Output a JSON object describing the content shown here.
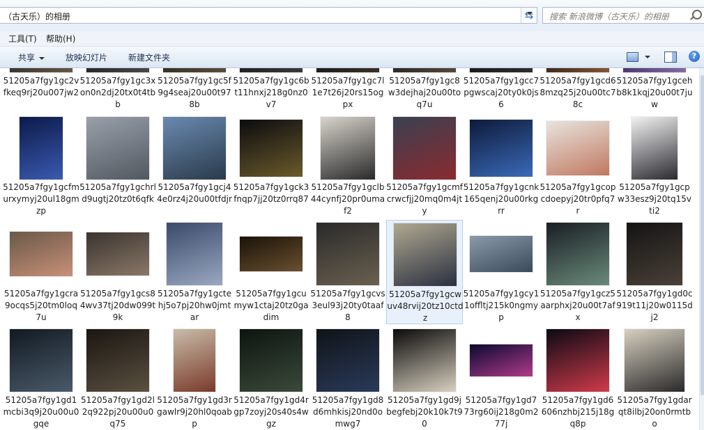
{
  "address": {
    "path": "（古天乐）的相册"
  },
  "search": {
    "placeholder": "搜索 新浪微博（古天乐）的相册"
  },
  "menu": [
    {
      "label": "工具(T)"
    },
    {
      "label": "帮助(H)"
    }
  ],
  "toolbar": {
    "share_label": "共享",
    "slideshow_label": "放映幻灯片",
    "new_folder_label": "新建文件夹",
    "help_symbol": "?"
  },
  "rows": [
    [
      {
        "label": "51205a7fgy1gc2vfkeq9rj20u007jw2",
        "colors": [
          "#2a2a2a",
          "#6b5a44"
        ]
      },
      {
        "label": "51205a7fgy1gc3xon0n2dj20tx0t4tbb",
        "colors": [
          "#1e1e1e",
          "#4a4a4a"
        ]
      },
      {
        "label": "51205a7fgy1gc5f9g4seaj20u00t978b",
        "colors": [
          "#2c2820",
          "#5c4f3c"
        ]
      },
      {
        "label": "51205a7fgy1gc6bt11hnxj218g0nz0v7",
        "colors": [
          "#1a1a1a",
          "#3a3a3a"
        ]
      },
      {
        "label": "51205a7fgy1gc7l1e7t26j20rs15ogpx",
        "colors": [
          "#151515",
          "#3a3226"
        ]
      },
      {
        "label": "51205a7fgy1gc8w3dejhaj20u00toq7u",
        "colors": [
          "#1f1f1f",
          "#5a4a3a"
        ]
      },
      {
        "label": "51205a7fgy1gcc7pgwscaj20ty0k0js6",
        "colors": [
          "#141414",
          "#2e2e2e"
        ]
      },
      {
        "label": "51205a7fgy1gcd68mzq25j20u00tc78c",
        "colors": [
          "#2a1a12",
          "#8a5a36"
        ]
      },
      {
        "label": "51205a7fgy1gcehb8k1kqj20u00t7juw",
        "colors": [
          "#3a2a5a",
          "#8a70a8"
        ]
      }
    ],
    [
      {
        "label": "51205a7fgy1gcfmurxymyj20ul18gmzp",
        "colors": [
          "#0c1a4a",
          "#3a5ab0"
        ]
      },
      {
        "label": "51205a7fgy1gchrld9ugtj20tz0t6qfk",
        "colors": [
          "#9aa0aa",
          "#505860"
        ]
      },
      {
        "label": "51205a7fgy1gcj44e0rz4j20u00tfdjr",
        "colors": [
          "#6a8ab0",
          "#2a3a4a"
        ]
      },
      {
        "label": "51205a7fgy1gck3fnqp7jj20tz0rrq87",
        "colors": [
          "#0c0c10",
          "#6a5a2a"
        ]
      },
      {
        "label": "51205a7fgy1gclb44cynfj20pr0umaf2",
        "colors": [
          "#d8d4cc",
          "#2a2a2a"
        ]
      },
      {
        "label": "51205a7fgy1gcmfcrwcfjj20mq0m4jty",
        "colors": [
          "#3a4050",
          "#8a2a30"
        ]
      },
      {
        "label": "51205a7fgy1gcnk165qenj20u00rkgrr",
        "colors": [
          "#0e1a3a",
          "#3a6ab8"
        ]
      },
      {
        "label": "51205a7fgy1gcopcdoepyj20tr0pfq7r",
        "colors": [
          "#e8e4de",
          "#c07860"
        ]
      },
      {
        "label": "51205a7fgy1gcpw33esz9j20tq15vti2",
        "colors": [
          "#f2f2f2",
          "#2a2a30"
        ]
      }
    ],
    [
      {
        "label": "51205a7fgy1gcra9ocqs5j20tm0loq7u",
        "colors": [
          "#6a5848",
          "#c89078"
        ]
      },
      {
        "label": "51205a7fgy1gcs84wv37tj20dw099t9k",
        "colors": [
          "#3a3430",
          "#8a7868"
        ]
      },
      {
        "label": "51205a7fgy1gctehj5o7pj20hw0jmtar",
        "colors": [
          "#3a4a6a",
          "#9aa8c0"
        ]
      },
      {
        "label": "51205a7fgy1gcumyw1ctaj20tz0gadim",
        "colors": [
          "#1a1208",
          "#6a5030"
        ]
      },
      {
        "label": "51205a7fgy1gcvs3eul93j20ty0taaf8",
        "colors": [
          "#2a2a2a",
          "#6a6050"
        ]
      },
      {
        "label": "51205a7fgy1gcwuv48rvij20tz10ctdz",
        "colors": [
          "#b0a890",
          "#2a3040"
        ]
      },
      {
        "label": "51205a7fgy1gcy11offltj215k0ngmyp",
        "colors": [
          "#8a9aaa",
          "#3a4a5a"
        ]
      },
      {
        "label": "51205a7fgy1gcz5aarphxj20u00t7afx",
        "colors": [
          "#1a1e24",
          "#6a8a7a"
        ]
      },
      {
        "label": "51205a7fgy1gd0c919t11j20w0115dj2",
        "colors": [
          "#141414",
          "#4a4038"
        ]
      }
    ],
    [
      {
        "label": "51205a7fgy1gd1mcbi3q9j20u00u0gqe",
        "colors": [
          "#121a22",
          "#4a5a6a"
        ]
      },
      {
        "label": "51205a7fgy1gd2l2q922pj20u00u0q75",
        "colors": [
          "#1a1612",
          "#5a5040"
        ]
      },
      {
        "label": "51205a7fgy1gd3rgawlr9j20hl0qoabp",
        "colors": [
          "#c8bca8",
          "#7a3a2a"
        ]
      },
      {
        "label": "51205a7fgy1gd4rgp7zoyj20s40s4wgz",
        "colors": [
          "#0e1410",
          "#3a4a3a"
        ]
      },
      {
        "label": "51205a7fgy1gd8d6mhkisj20nd0omwg7",
        "colors": [
          "#101418",
          "#2a3a5a"
        ]
      },
      {
        "label": "51205a7fgy1gd9jbegfebj20k10k7t90",
        "colors": [
          "#0a0a0a",
          "#d8d0c0"
        ]
      },
      {
        "label": "51205a7fgy1gd773rg60ij218g0m277j",
        "colors": [
          "#0a0a30",
          "#b03a8a"
        ]
      },
      {
        "label": "51205a7fgy1gd6606nzhbj215j18gq8p",
        "colors": [
          "#0a0a14",
          "#d03a4a"
        ]
      },
      {
        "label": "51205a7fgy1gdarqt8ilbj20on0rmtbo",
        "colors": [
          "#d8d0c0",
          "#2a2a2a"
        ]
      }
    ]
  ]
}
